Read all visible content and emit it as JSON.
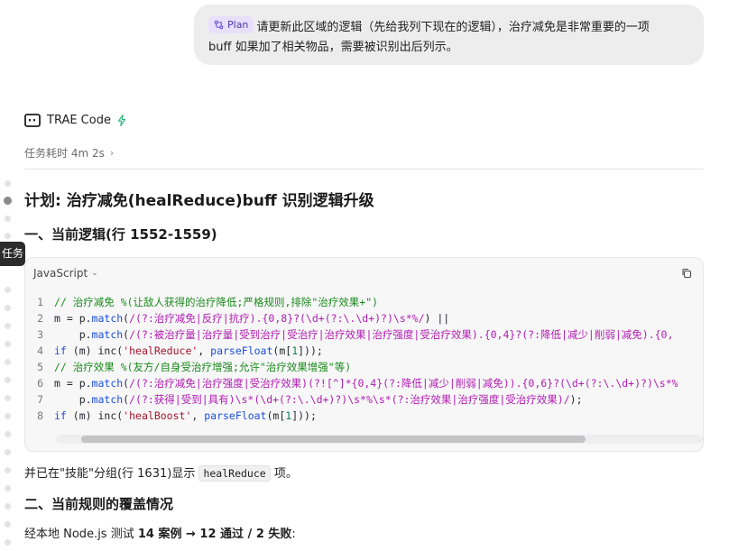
{
  "user_message": {
    "tag": "Plan",
    "line1": "请更新此区域的逻辑（先给我列下现在的逻辑），治疗减免是非常重要的一项",
    "line2": "buff 如果加了相关物品，需要被识别出后列示。"
  },
  "agent": {
    "name": "TRAE Code",
    "duration": "任务耗时 4m 2s",
    "rail_tab": "任务"
  },
  "plan": {
    "title": "计划: 治疗减免(healReduce)buff 识别逻辑升级",
    "section1": "一、当前逻辑(行 1552-1559)",
    "code_lang": "JavaScript",
    "line_numbers": [
      "1",
      "2",
      "3",
      "4",
      "5",
      "6",
      "7",
      "8"
    ],
    "para1_pre": "并已在\"技能\"分组(行 1631)显示 ",
    "para1_code": "healReduce",
    "para1_post": " 项。",
    "section2": "二、当前规则的覆盖情况",
    "para2_pre": "经本地 Node.js 测试 ",
    "para2_bold": "14 案例 → 12 通过 / 2 失败",
    "para2_post": ":"
  },
  "code": {
    "l1_cmt": "// 治疗减免 %(让敌人获得的治疗降低;严格规则,排除\"治疗效果+\")",
    "l2_a": "m = p.",
    "l2_fn": "match",
    "l2_b": "(",
    "l2_rx": "/(?:治疗减免|反疗|抗疗).{0,8}?(\\d+(?:\\.\\d+)?)\\s*%/",
    "l2_c": ") ||",
    "l3_a": "    p.",
    "l3_fn": "match",
    "l3_b": "(",
    "l3_rx": "/(?:被治疗量|治疗量|受到治疗|受治疗|治疗效果|治疗强度|受治疗效果).{0,4}?(?:降低|减少|削弱|减免).{0,",
    "l4_kw": "if",
    "l4_a": " (m) ",
    "l4_fn": "inc",
    "l4_b": "(",
    "l4_str": "'healReduce'",
    "l4_c": ", ",
    "l4_fn2": "parseFloat",
    "l4_d": "(m[",
    "l4_num": "1",
    "l4_e": "]));",
    "l5_cmt": "// 治疗效果 %(友方/自身受治疗增强;允许\"治疗效果增强\"等)",
    "l6_a": "m = p.",
    "l6_fn": "match",
    "l6_b": "(",
    "l6_rx": "/(?:治疗减免|治疗强度|受治疗效果)(?![^]*{0,4}(?:降低|减少|削弱|减免)).{0,6}?(\\d+(?:\\.\\d+)?)\\s*%",
    "l7_a": "    p.",
    "l7_fn": "match",
    "l7_b": "(",
    "l7_rx": "/(?:获得|受到|具有)\\s*(\\d+(?:\\.\\d+)?)\\s*%\\s*(?:治疗效果|治疗强度|受治疗效果)/",
    "l7_c": ");",
    "l8_kw": "if",
    "l8_a": " (m) ",
    "l8_fn": "inc",
    "l8_b": "(",
    "l8_str": "'healBoost'",
    "l8_c": ", ",
    "l8_fn2": "parseFloat",
    "l8_d": "(m[",
    "l8_num": "1",
    "l8_e": "]));"
  }
}
